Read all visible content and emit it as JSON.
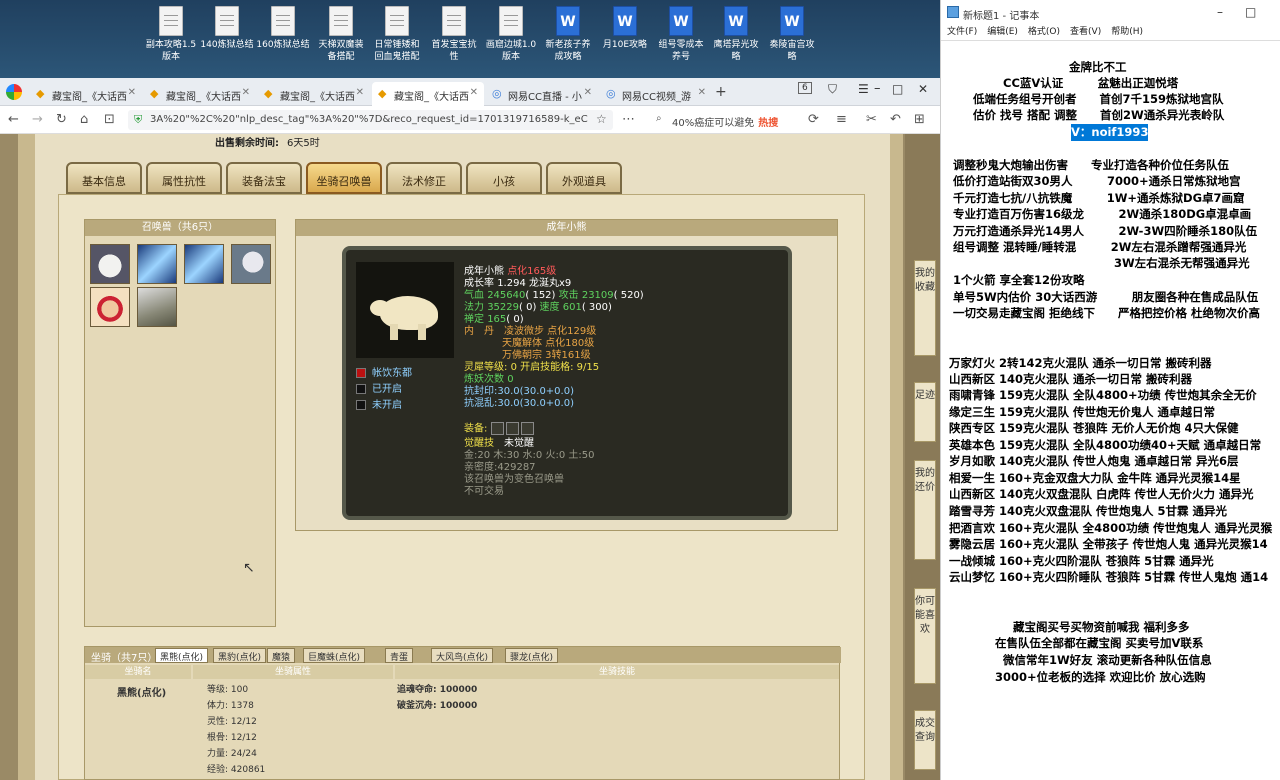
{
  "desktop_icons": [
    {
      "label1": "副本攻略1.5",
      "label2": "版本",
      "type": "doc"
    },
    {
      "label1": "140炼狱总结",
      "label2": "",
      "type": "doc"
    },
    {
      "label1": "160炼狱总结",
      "label2": "",
      "type": "doc"
    },
    {
      "label1": "天梯双魔装",
      "label2": "备搭配",
      "type": "doc"
    },
    {
      "label1": "日常锤矮和",
      "label2": "回血鬼搭配",
      "type": "doc"
    },
    {
      "label1": "首发宝宝抗",
      "label2": "性",
      "type": "doc"
    },
    {
      "label1": "画窟边城1.0",
      "label2": "版本",
      "type": "doc"
    },
    {
      "label1": "新老孩子养",
      "label2": "成攻略",
      "type": "word"
    },
    {
      "label1": "月10E攻略",
      "label2": "",
      "type": "word"
    },
    {
      "label1": "组号零成本",
      "label2": "养号",
      "type": "word"
    },
    {
      "label1": "鹰塔异光攻",
      "label2": "略",
      "type": "word"
    },
    {
      "label1": "奏陵宙宫攻",
      "label2": "略",
      "type": "word"
    }
  ],
  "browser": {
    "tabs": [
      {
        "label": "藏宝阁_《大话西",
        "active": false,
        "icon": "treasure-icon"
      },
      {
        "label": "藏宝阁_《大话西",
        "active": false,
        "icon": "treasure-icon"
      },
      {
        "label": "藏宝阁_《大话西",
        "active": false,
        "icon": "treasure-icon"
      },
      {
        "label": "藏宝阁_《大话西",
        "active": true,
        "icon": "treasure-icon"
      },
      {
        "label": "网易CC直播 - 小",
        "active": false,
        "icon": "cc-icon"
      },
      {
        "label": "网易CC视频_游",
        "active": false,
        "icon": "cc-icon"
      }
    ],
    "new_tab": "+",
    "tab_count": "6",
    "url": "3A%20\"%2C%20\"nlp_desc_tag\"%3A%20\"%7D&reco_request_id=1701319716589-k_eC",
    "search_text": "40%癌症可以避免",
    "search_hot": "热搜"
  },
  "game": {
    "sell_time_label": "出售剩余时间:",
    "sell_time_value": "6天5时",
    "tabs": [
      "基本信息",
      "属性抗性",
      "装备法宝",
      "坐骑召唤兽",
      "法术修正",
      "小孩",
      "外观道具"
    ],
    "active_tab": 3,
    "summon_box_title": "召唤兽（共6只）",
    "pet_box_title": "成年小熊",
    "pet": {
      "name": "成年小熊",
      "rank": "点化165级",
      "growth_label": "成长率",
      "growth": "1.294",
      "dan": "龙涎丸x9",
      "hp_label": "气血",
      "hp": "245640",
      "hp_add": "( 152)",
      "atk_label": "攻击",
      "atk": "23109",
      "atk_add": "( 520)",
      "mp_label": "法力",
      "mp": "35229",
      "mp_add": "( 0)",
      "spd_label": "速度",
      "spd": "601",
      "spd_add": "( 300)",
      "ding_label": "禅定",
      "ding": "165",
      "ding_add": "( 0)",
      "neidan_label": "内　丹",
      "neidan1": "凌波微步 点化129级",
      "neidan2": "天魔解体 点化180级",
      "neidan3": "万佛朝宗 3转161级",
      "skill1": "帐饮东都",
      "skill2": "已开启",
      "skill3": "未开启",
      "spirit_label": "灵犀等级:",
      "spirit_value": "0 开启技能格:",
      "spirit_slots": "9/15",
      "yao_label": "炼妖次数",
      "yao": "0",
      "kf_label": "抗封印:",
      "kf": "30.0(30.0+0.0)",
      "kh_label": "抗混乱:",
      "kh": "30.0(30.0+0.0)",
      "equip_label": "装备:",
      "awaken_label": "觉醒技",
      "awaken_value": "未觉醒",
      "elements": "金:20 木:30 水:0 火:0 土:50",
      "intimacy_label": "亲密度:",
      "intimacy": "429287",
      "note1": "该召唤兽为变色召唤兽",
      "note2": "不可交易"
    },
    "mount": {
      "title": "坐骑（共7只）",
      "tabs": [
        "黑熊(点化)",
        "黑豹(点化)",
        "魔猿",
        "巨魔蛛(点化)",
        "青蛋",
        "大风鸟(点化)",
        "骤龙(点化)"
      ],
      "col_name": "坐骑名",
      "col_attr": "坐骑属性",
      "col_skill": "坐骑技能",
      "name": "黑熊(点化)",
      "attrs": [
        {
          "k": "等级:",
          "v": "100"
        },
        {
          "k": "体力:",
          "v": "1378"
        },
        {
          "k": "灵性:",
          "v": "12/12"
        },
        {
          "k": "根骨:",
          "v": "12/12"
        },
        {
          "k": "力量:",
          "v": "24/24"
        },
        {
          "k": "经验:",
          "v": "420861"
        }
      ],
      "skills": [
        {
          "k": "追魂夺命:",
          "v": "100000"
        },
        {
          "k": "破釜沉舟:",
          "v": "100000"
        }
      ]
    },
    "side_tabs": [
      "我的收藏",
      "足迹",
      "我的还价",
      "你可能喜欢",
      "成交查询"
    ]
  },
  "notepad": {
    "title": "新标题1 - 记事本",
    "menu": [
      "文件(F)",
      "编辑(E)",
      "格式(O)",
      "查看(V)",
      "帮助(H)"
    ],
    "lines": [
      "金牌比不工",
      "CC蓝V认证　　　盆魅出正迦悦塔",
      "低端任务组号开创者　　首创7千159炼狱地宫队",
      "估价 找号 搭配 调整　　首创2W通杀异光表岭队",
      "V：noif1993",
      "调整秒鬼大炮输出伤害　　专业打造各种价位任务队伍",
      "低价打造站街双30男人　　　7000+通杀日常炼狱地宫",
      "千元打造七抗/八抗铁魔　　　1W+通杀炼狱DG卓7画窟",
      "专业打造百万伤害16级龙　　　2W通杀180DG卓混卓画",
      "万元打造通杀异光14男人　　　2W-3W四阶睡杀180队伍",
      "组号调整 混转睡/睡转混　　　2W左右混杀蹭帮强通异光",
      "　　　　　　　　　　　　　　3W左右混杀无帮强通异光",
      "1个火箭 享全套12份攻略",
      "单号5W内估价 30大话西游　　　朋友圈各种在售成品队伍",
      "一切交易走藏宝阁 拒绝线下　　严格把控价格 杜绝物次价高",
      "万家灯火 2转142克火混队 通杀一切日常 搬砖利器",
      "山西新区 140克火混队 通杀一切日常 搬砖利器",
      "雨啸青锋 159克火混队 全队4800+功绩 传世炮其余全无价",
      "缘定三生 159克火混队 传世炮无价鬼人 通卓越日常",
      "陕西专区 159克火混队 苍狼阵 无价人无价炮 4只大保健",
      "英雄本色 159克火混队 全队4800功绩40+天赋 通卓越日常",
      "岁月如歌 140克火混队 传世人炮鬼 通卓越日常 异光6层",
      "相爱一生 160+克金双盘大力队 金牛阵 通异光灵猴14星",
      "山西新区 140克火双盘混队 白虎阵 传世人无价火力 通异光",
      "踏雪寻芳 140克火双盘混队 传世炮鬼人 5甘霖 通异光",
      "把酒言欢 160+克火混队 全4800功绩 传世炮鬼人 通异光灵猴",
      "雾隐云居 160+克火混队 全带孩子 传世炮人鬼 通异光灵猴14",
      "一战倾城 160+克火四阶混队 苍狼阵 5甘霖 通异光",
      "云山梦忆 160+克火四阶睡队 苍狼阵 5甘霖 传世人鬼炮 通14",
      "藏宝阁买号买物资前喊我 福利多多",
      "在售队伍全部都在藏宝阁 买卖号加V联系",
      "微信常年1W好友 滚动更新各种队伍信息",
      "3000+位老板的选择 欢迎比价 放心选购"
    ]
  }
}
